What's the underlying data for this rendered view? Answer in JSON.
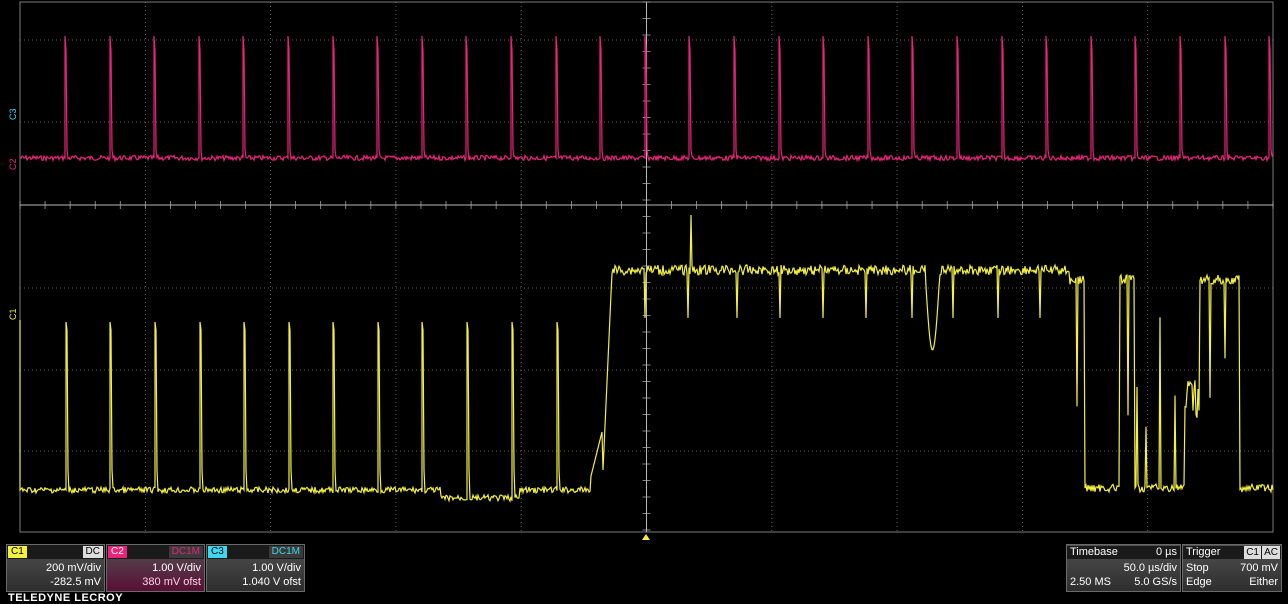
{
  "colors": {
    "c1": "#f3f040",
    "c2": "#e8237a",
    "c3": "#3fd7f0",
    "grid": "#7a7a7a",
    "axis": "#b8b8b8"
  },
  "markers": {
    "c3": "C3",
    "c2": "C2",
    "c1": "C1"
  },
  "channels": [
    {
      "tag": "C1",
      "coupling": "DC",
      "line1": "200 mV/div",
      "line2": "-282.5 mV"
    },
    {
      "tag": "C2",
      "coupling": "DC1M",
      "line1": "1.00 V/div",
      "line2": "380 mV ofst"
    },
    {
      "tag": "C3",
      "coupling": "DC1M",
      "line1": "1.00 V/div",
      "line2": "1.040 V ofst"
    }
  ],
  "timebase": {
    "label": "Timebase",
    "delay": "0 µs",
    "per_div": "50.0 µs/div",
    "samples": "2.50 MS",
    "rate": "5.0 GS/s"
  },
  "trigger": {
    "label": "Trigger",
    "source": "C1",
    "coupling": "AC",
    "mode": "Stop",
    "level": "700 mV",
    "type": "Edge",
    "slope": "Either"
  },
  "brand": "TELEDYNE LECROY"
}
